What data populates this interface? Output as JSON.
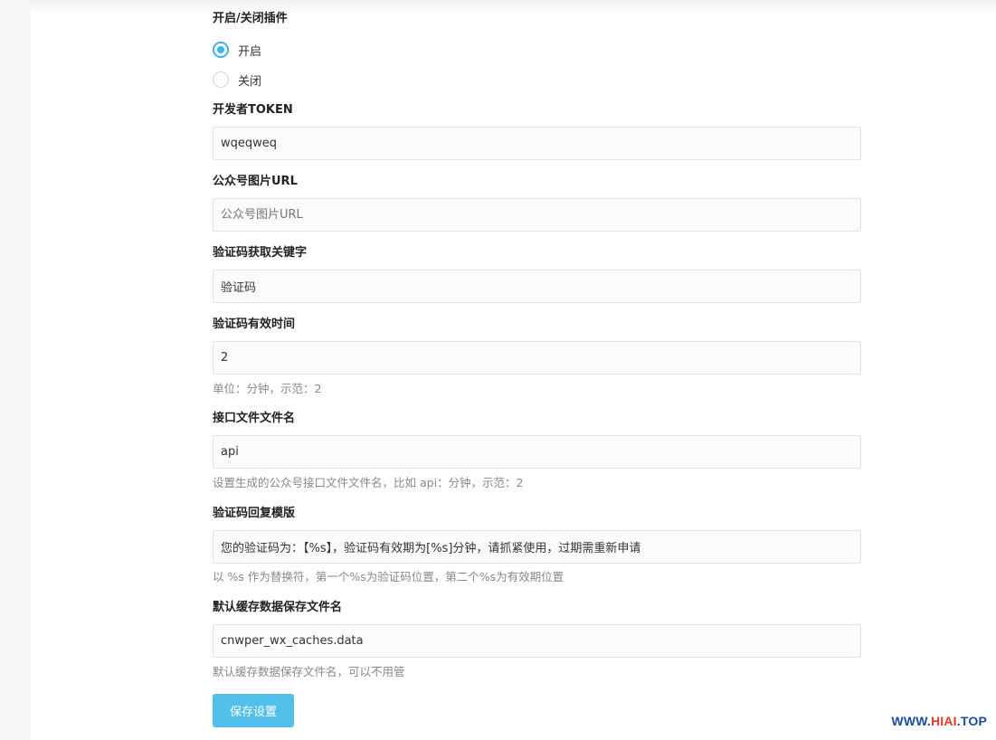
{
  "plugin_toggle": {
    "label": "开启/关闭插件",
    "options": [
      {
        "label": "开启",
        "checked": true
      },
      {
        "label": "关闭",
        "checked": false
      }
    ]
  },
  "fields": {
    "token": {
      "label": "开发者TOKEN",
      "value": "wqeqweq"
    },
    "image_url": {
      "label": "公众号图片URL",
      "value": "",
      "placeholder": "公众号图片URL"
    },
    "keyword": {
      "label": "验证码获取关键字",
      "value": "验证码"
    },
    "valid_time": {
      "label": "验证码有效时间",
      "value": "2",
      "help": "单位：分钟，示范：2"
    },
    "api_file": {
      "label": "接口文件文件名",
      "value": "api",
      "help": "设置生成的公众号接口文件文件名，比如 api：分钟，示范：2"
    },
    "reply_template": {
      "label": "验证码回复模版",
      "value": "您的验证码为：【%s】，验证码有效期为[%s]分钟，请抓紧使用，过期需重新申请",
      "help": "以 %s 作为替换符，第一个%s为验证码位置，第二个%s为有效期位置"
    },
    "cache_file": {
      "label": "默认缓存数据保存文件名",
      "value": "cnwper_wx_caches.data",
      "help": "默认缓存数据保存文件名，可以不用管"
    }
  },
  "save_button": {
    "label": "保存设置"
  },
  "watermark": {
    "prefix": "WWW.",
    "accent": "HIAI",
    "suffix": ".TOP"
  },
  "colors": {
    "accent": "#3fb2e6",
    "button": "#52c0ea",
    "watermark_blue": "#1a4fa0",
    "watermark_red": "#e23a2a"
  }
}
